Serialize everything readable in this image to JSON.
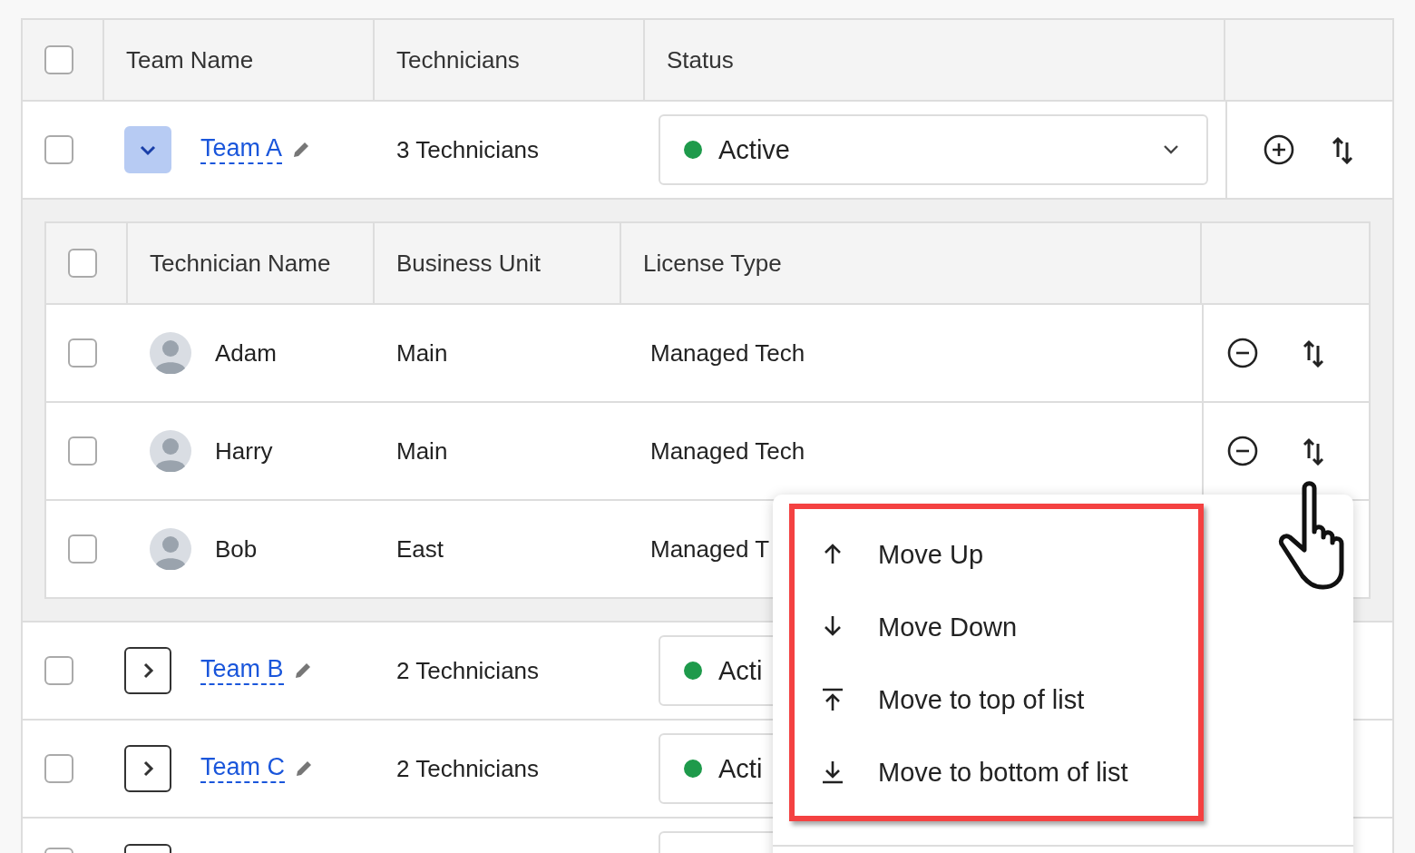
{
  "table": {
    "columns": [
      "Team Name",
      "Technicians",
      "Status"
    ],
    "header_checked": false,
    "teams": [
      {
        "name": "Team A",
        "checked": false,
        "expanded": true,
        "technicians": "3 Technicians",
        "status": "Active",
        "caret": true,
        "sub_table": {
          "columns": [
            "Technician Name",
            "Business Unit",
            "License Type"
          ],
          "header_checked": false,
          "rows": [
            {
              "name": "Adam",
              "checked": false,
              "business_unit": "Main",
              "license": "Managed Tech"
            },
            {
              "name": "Harry",
              "menu_open": true,
              "checked": false,
              "business_unit": "Main",
              "license": "Managed Tech"
            },
            {
              "name": "Bob",
              "checked": false,
              "business_unit": "East",
              "license": "Managed T"
            }
          ]
        }
      },
      {
        "name": "Team B",
        "checked": false,
        "expanded": false,
        "technicians": "2 Technicians",
        "status": "Acti",
        "caret": false
      },
      {
        "name": "Team C",
        "checked": false,
        "expanded": false,
        "technicians": "2 Technicians",
        "status": "Acti",
        "caret": false
      }
    ],
    "more_rows_below": true
  },
  "reorder_menu": {
    "items": [
      {
        "label": "Move Up",
        "kind": "up"
      },
      {
        "label": "Move Down",
        "kind": "down"
      },
      {
        "label": "Move to top of list",
        "kind": "top"
      },
      {
        "label": "Move to bottom of list",
        "kind": "bottom"
      }
    ]
  }
}
